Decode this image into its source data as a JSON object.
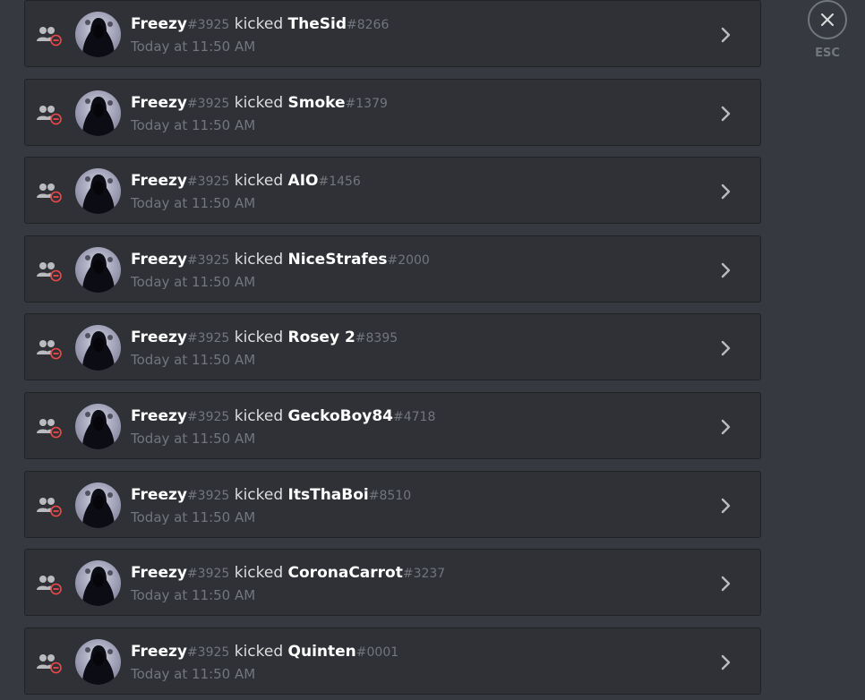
{
  "close": {
    "label": "ESC"
  },
  "entries": [
    {
      "actor": "Freezy",
      "actor_disc": "#3925",
      "verb": "kicked",
      "target": "TheSid",
      "target_disc": "#8266",
      "time": "Today at 11:50 AM"
    },
    {
      "actor": "Freezy",
      "actor_disc": "#3925",
      "verb": "kicked",
      "target": "Smoke",
      "target_disc": "#1379",
      "time": "Today at 11:50 AM"
    },
    {
      "actor": "Freezy",
      "actor_disc": "#3925",
      "verb": "kicked",
      "target": "AIO",
      "target_disc": "#1456",
      "time": "Today at 11:50 AM"
    },
    {
      "actor": "Freezy",
      "actor_disc": "#3925",
      "verb": "kicked",
      "target": "NiceStrafes",
      "target_disc": "#2000",
      "time": "Today at 11:50 AM"
    },
    {
      "actor": "Freezy",
      "actor_disc": "#3925",
      "verb": "kicked",
      "target": "Rosey 2",
      "target_disc": "#8395",
      "time": "Today at 11:50 AM"
    },
    {
      "actor": "Freezy",
      "actor_disc": "#3925",
      "verb": "kicked",
      "target": "GeckoBoy84",
      "target_disc": "#4718",
      "time": "Today at 11:50 AM"
    },
    {
      "actor": "Freezy",
      "actor_disc": "#3925",
      "verb": "kicked",
      "target": "ItsThaBoi",
      "target_disc": "#8510",
      "time": "Today at 11:50 AM"
    },
    {
      "actor": "Freezy",
      "actor_disc": "#3925",
      "verb": "kicked",
      "target": "CoronaCarrot",
      "target_disc": "#3237",
      "time": "Today at 11:50 AM"
    },
    {
      "actor": "Freezy",
      "actor_disc": "#3925",
      "verb": "kicked",
      "target": "Quinten",
      "target_disc": "#0001",
      "time": "Today at 11:50 AM"
    }
  ],
  "icons": {
    "action": "member-kick-icon",
    "expand": "chevron-right-icon",
    "close": "close-icon"
  },
  "colors": {
    "background": "#36393f",
    "entry_background": "#2f3136",
    "kick_red": "#f04747",
    "muted_text": "#72767d"
  }
}
